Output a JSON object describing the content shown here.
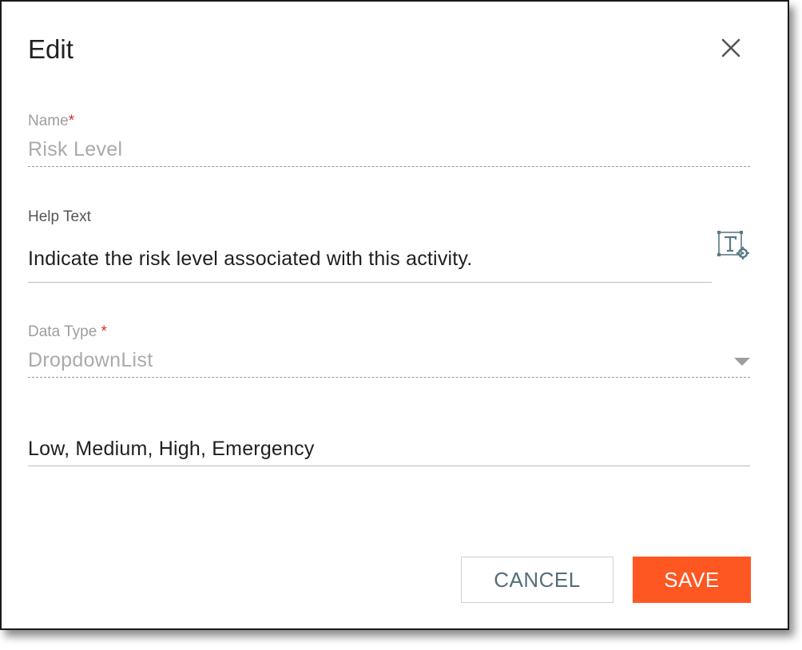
{
  "dialog": {
    "title": "Edit",
    "close_icon": "close-icon"
  },
  "name_field": {
    "label": "Name",
    "required_mark": "*",
    "value": "Risk Level"
  },
  "help_field": {
    "label": "Help Text",
    "value": "Indicate the risk level associated with this activity.",
    "format_icon": "text-format-settings-icon"
  },
  "data_type_field": {
    "label": "Data Type",
    "required_mark": "*",
    "selected": "DropdownList",
    "caret_icon": "dropdown-caret-icon"
  },
  "options_field": {
    "value": "Low, Medium, High, Emergency"
  },
  "buttons": {
    "cancel_label": "CANCEL",
    "save_label": "SAVE"
  },
  "colors": {
    "accent": "#ff5722",
    "required": "#d32f2f",
    "secondary_text": "#546e7a"
  }
}
